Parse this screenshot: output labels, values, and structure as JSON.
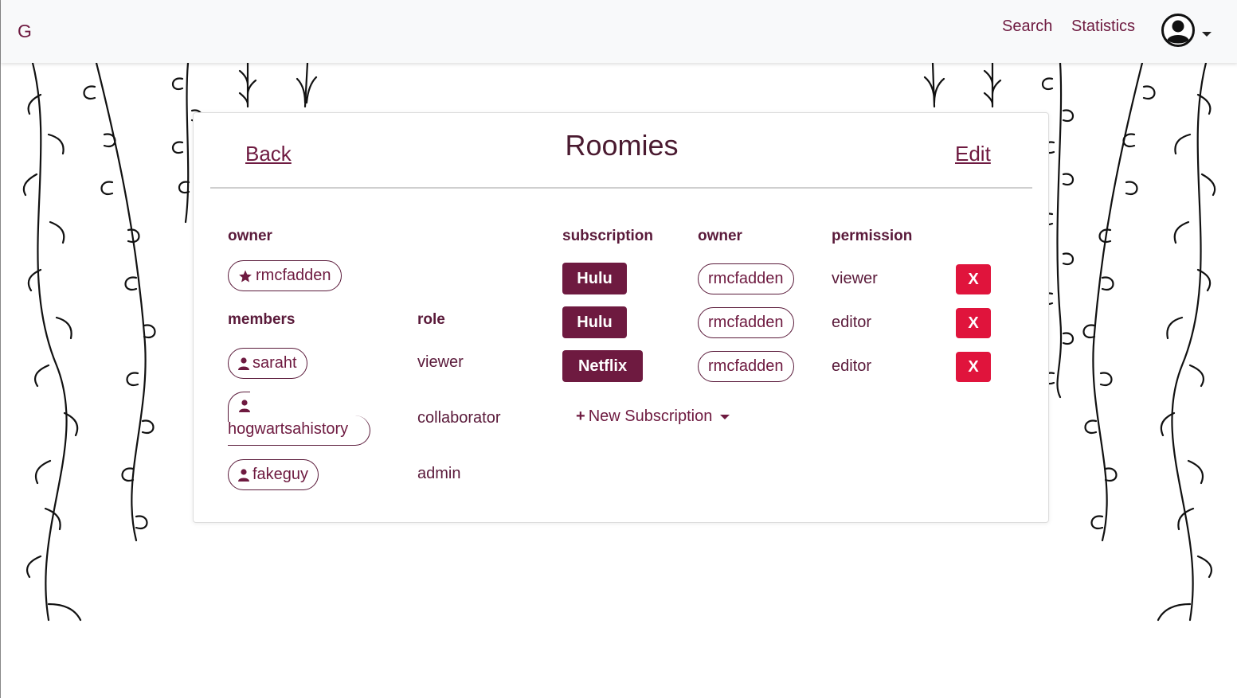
{
  "navbar": {
    "brand": "G",
    "links": [
      "Search",
      "Statistics"
    ]
  },
  "group": {
    "title": "Roomies",
    "back_label": "Back",
    "edit_label": "Edit"
  },
  "owner_section": {
    "header": "owner",
    "owner": "rmcfadden"
  },
  "members_section": {
    "members_header": "members",
    "role_header": "role",
    "members": [
      {
        "name": "saraht",
        "role": "viewer"
      },
      {
        "name": "hogwartsahistory",
        "role": "collaborator"
      },
      {
        "name": "fakeguy",
        "role": "admin"
      }
    ]
  },
  "subscriptions_section": {
    "headers": {
      "subscription": "subscription",
      "owner": "owner",
      "permission": "permission"
    },
    "rows": [
      {
        "service": "Hulu",
        "owner": "rmcfadden",
        "permission": "viewer",
        "remove_label": "X"
      },
      {
        "service": "Hulu",
        "owner": "rmcfadden",
        "permission": "editor",
        "remove_label": "X"
      },
      {
        "service": "Netflix",
        "owner": "rmcfadden",
        "permission": "editor",
        "remove_label": "X"
      }
    ],
    "new_subscription_label": "New Subscription"
  },
  "colors": {
    "accent": "#6e1a40",
    "danger": "#e0143c",
    "navbar_bg": "#f8f9fa"
  },
  "icons": {
    "owner": "star-icon",
    "member": "user-icon",
    "avatar": "user-circle-icon",
    "add": "plus-icon"
  }
}
